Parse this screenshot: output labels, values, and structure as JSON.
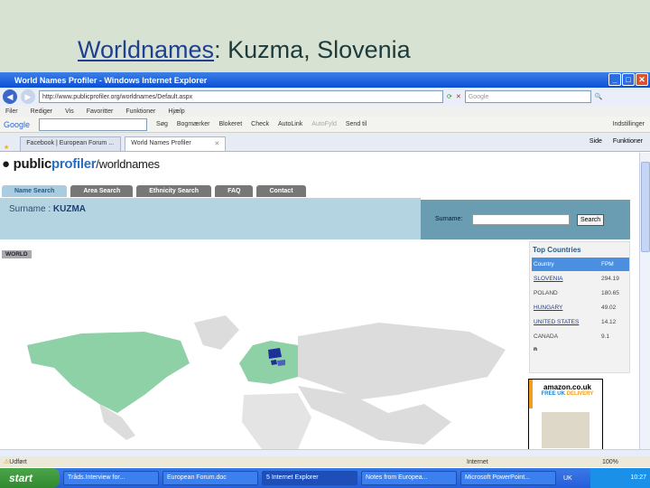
{
  "slide": {
    "title_link": "Worldnames",
    "title_rest": ": Kuzma, Slovenia"
  },
  "browser": {
    "title": "World Names Profiler - Windows Internet Explorer",
    "url": "http://www.publicprofiler.org/worldnames/Default.aspx",
    "search_placeholder": "Google",
    "menu": [
      "Filer",
      "Rediger",
      "Vis",
      "Favoritter",
      "Funktioner",
      "Hjælp"
    ],
    "google_toolbar": [
      "Google",
      "Søg",
      "Bogmærker",
      "Blokeret",
      "Check",
      "AutoLink",
      "AutoFyld",
      "Send til",
      "Indstillinger"
    ],
    "tabs": [
      "Facebook | European Forum ...",
      "World Names Profiler"
    ],
    "tab_tools": [
      "Side",
      "Funktioner"
    ]
  },
  "site": {
    "logo_a": "public",
    "logo_b": "profiler",
    "logo_c": "/worldnames",
    "nav": [
      "Name Search",
      "Area Search",
      "Ethnicity Search",
      "FAQ",
      "Contact"
    ],
    "surname_label": "Surname : ",
    "surname": "KUZMA",
    "search_label": "Surname:",
    "search_button": "Search",
    "world_label": "WORLD",
    "top_countries": {
      "title": "Top Countries",
      "headers": [
        "Country",
        "FPM"
      ],
      "rows": [
        {
          "country": "SLOVENIA",
          "fpm": "294.19",
          "link": true
        },
        {
          "country": "POLAND",
          "fpm": "180.65",
          "link": false
        },
        {
          "country": "HUNGARY",
          "fpm": "49.02",
          "link": true
        },
        {
          "country": "UNITED STATES",
          "fpm": "14.12",
          "link": true
        },
        {
          "country": "CANADA",
          "fpm": "9.1",
          "link": false
        }
      ],
      "more": "n"
    },
    "ad": {
      "brand": "amazon.co.uk",
      "line_a": "FREE UK",
      "line_b": "DELIVERY"
    }
  },
  "status": {
    "left": "Udført",
    "zone": "Internet",
    "zoom": "100%"
  },
  "taskbar": {
    "start": "start",
    "items": [
      "Tråds.Interview for...",
      "European Forum.doc",
      "5 Internet Explorer",
      "Notes from Europea...",
      "Microsoft PowerPoint..."
    ],
    "tray": "UK",
    "clock": "10:27"
  },
  "colors": {
    "highlight": "#8fd1a7",
    "top": "#1f2f9a",
    "mid": "#4d5fc0",
    "grey": "#dcdcdc"
  }
}
